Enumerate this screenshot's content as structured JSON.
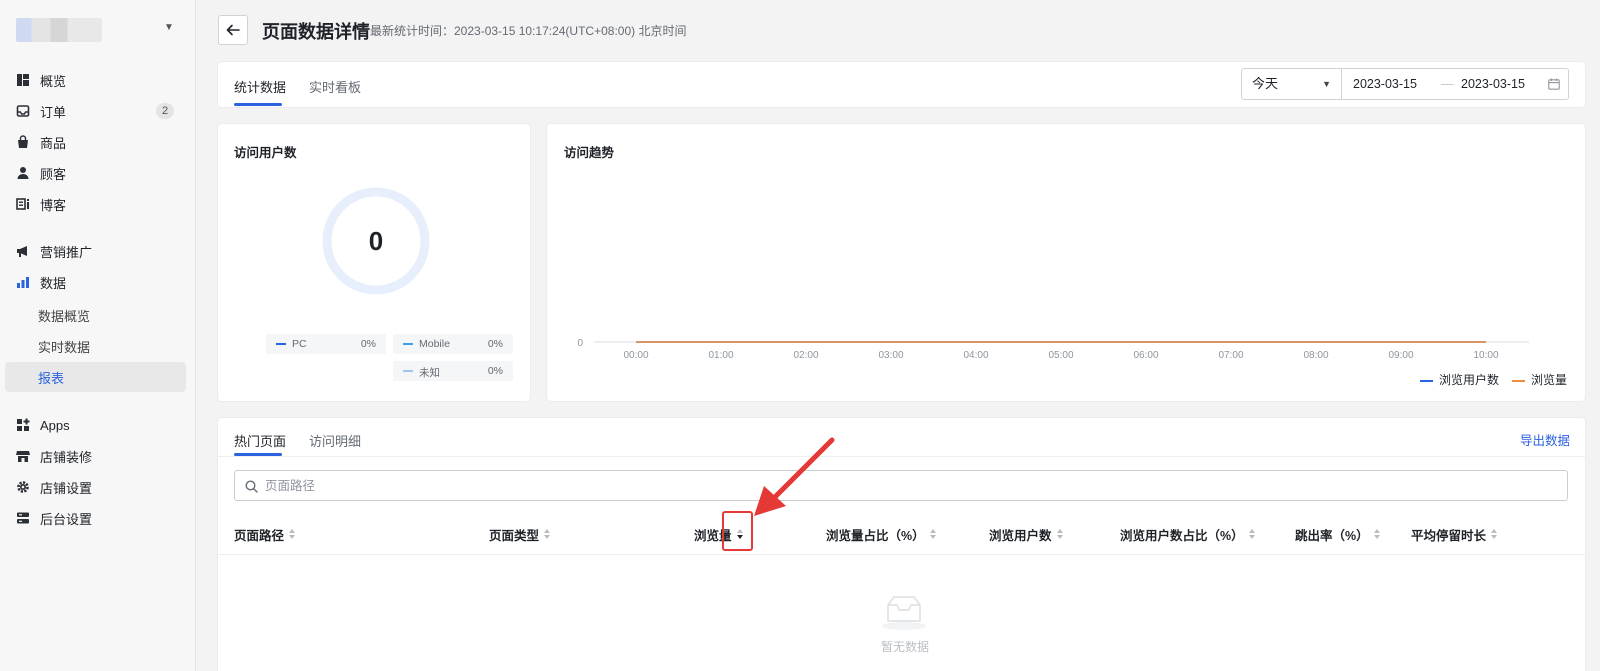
{
  "sidebar": {
    "nav": [
      {
        "label": "概览",
        "icon": "overview-icon"
      },
      {
        "label": "订单",
        "icon": "inbox-icon",
        "badge": "2"
      },
      {
        "label": "商品",
        "icon": "bag-icon"
      },
      {
        "label": "顾客",
        "icon": "person-icon"
      },
      {
        "label": "博客",
        "icon": "blog-icon"
      },
      {
        "label": "营销推广",
        "icon": "megaphone-icon"
      },
      {
        "label": "数据",
        "icon": "bar-chart-icon"
      },
      {
        "label": "Apps",
        "icon": "apps-icon"
      },
      {
        "label": "店铺装修",
        "icon": "store-icon"
      },
      {
        "label": "店铺设置",
        "icon": "gear-icon"
      },
      {
        "label": "后台设置",
        "icon": "server-icon"
      }
    ],
    "data_sub": [
      {
        "label": "数据概览"
      },
      {
        "label": "实时数据"
      },
      {
        "label": "报表",
        "active": true
      }
    ]
  },
  "header": {
    "title": "页面数据详情",
    "stat_time": "最新统计时间：2023-03-15 10:17:24(UTC+08:00) 北京时间"
  },
  "top_tabs": [
    "统计数据",
    "实时看板"
  ],
  "date_filter": {
    "range": "今天",
    "start": "2023-03-15",
    "separator": "—",
    "end": "2023-03-15"
  },
  "visitors_card": {
    "title": "访问用户数",
    "total": "0",
    "legend": [
      {
        "label": "PC",
        "pct": "0%",
        "color": "#2a62e0"
      },
      {
        "label": "Mobile",
        "pct": "0%",
        "color": "#3fa2e8"
      },
      {
        "label": "未知",
        "pct": "0%",
        "color": "#9bc7ef"
      }
    ]
  },
  "trend_card": {
    "title": "访问趋势",
    "legend": [
      {
        "label": "浏览用户数",
        "color": "#2a62e0"
      },
      {
        "label": "浏览量",
        "color": "#f08c3a"
      }
    ]
  },
  "chart_data": {
    "type": "line",
    "x": [
      "00:00",
      "01:00",
      "02:00",
      "03:00",
      "04:00",
      "05:00",
      "06:00",
      "07:00",
      "08:00",
      "09:00",
      "10:00"
    ],
    "y_ticks": [
      "0"
    ],
    "series": [
      {
        "name": "浏览用户数",
        "values": [
          0,
          0,
          0,
          0,
          0,
          0,
          0,
          0,
          0,
          0,
          0
        ],
        "color": "#2a62e0"
      },
      {
        "name": "浏览量",
        "values": [
          0,
          0,
          0,
          0,
          0,
          0,
          0,
          0,
          0,
          0,
          0
        ],
        "color": "#f08c3a"
      }
    ],
    "title": "访问趋势"
  },
  "bottom_tabs": [
    "热门页面",
    "访问明细"
  ],
  "export_label": "导出数据",
  "search": {
    "placeholder": "页面路径",
    "value": ""
  },
  "table": {
    "columns": [
      "页面路径",
      "页面类型",
      "浏览量",
      "浏览量占比（%）",
      "浏览用户数",
      "浏览用户数占比（%）",
      "跳出率（%）",
      "平均停留时长"
    ],
    "rows": [],
    "empty_text": "暂无数据"
  }
}
